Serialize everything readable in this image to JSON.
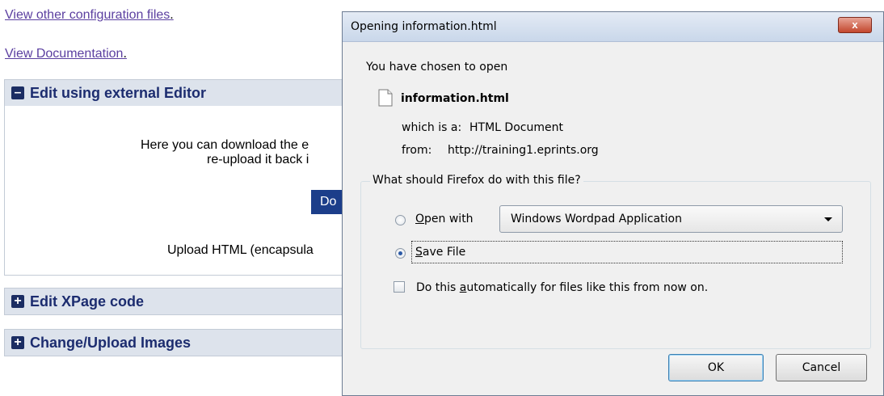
{
  "page": {
    "links": {
      "other_config": "View other configuration files",
      "documentation": "View Documentation",
      "dot": "."
    },
    "panels": [
      {
        "label": "Edit using external Editor",
        "state": "expanded",
        "toggle": "–"
      },
      {
        "label": "Edit XPage code",
        "state": "collapsed",
        "toggle": "+"
      },
      {
        "label": "Change/Upload Images",
        "state": "collapsed",
        "toggle": "+"
      }
    ],
    "panel_body": {
      "line1": "Here you can download the e",
      "line2": "re-upload it back i",
      "button_label": "Do",
      "upload_text": "Upload HTML (encapsula"
    }
  },
  "dialog": {
    "title": "Opening information.html",
    "close_glyph": "x",
    "intro": "You have chosen to open",
    "file_name": "information.html",
    "which_is_label": "which is a:",
    "which_is_value": "HTML Document",
    "from_label": "from:",
    "from_value": "http://training1.eprints.org",
    "question": "What should Firefox do with this file?",
    "open_with": {
      "accel": "O",
      "rest": "pen with"
    },
    "open_with_app": "Windows Wordpad Application",
    "save_file": {
      "accel": "S",
      "rest": "ave File"
    },
    "auto": {
      "before": "Do this ",
      "accel": "a",
      "after": "utomatically for files like this from now on."
    },
    "ok_label": "OK",
    "cancel_label": "Cancel",
    "selected_option": "save_file",
    "auto_checked": false
  },
  "colors": {
    "link": "#5b3fa0",
    "panel_header_bg": "#dde3ec",
    "panel_title": "#1c2c6f",
    "close_button": "#c3472d"
  }
}
